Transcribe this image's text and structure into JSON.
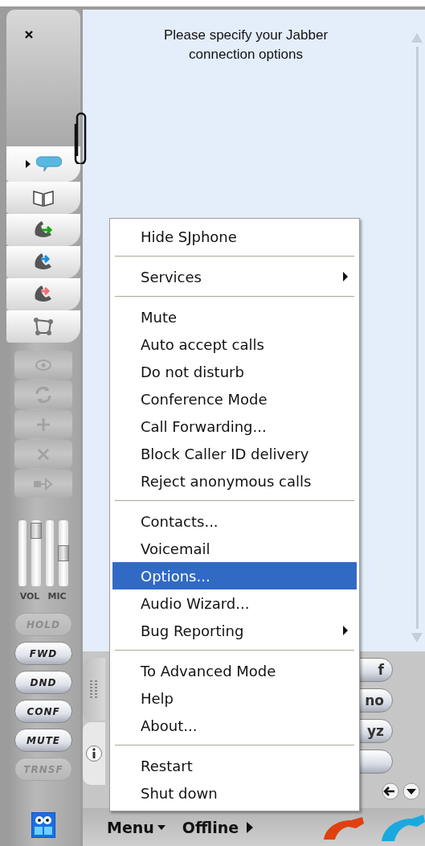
{
  "prompt": "Please specify your Jabber connection options",
  "side_tabs": [
    {
      "kind": "chat",
      "selected": true
    },
    {
      "kind": "book",
      "selected": false
    },
    {
      "kind": "incoming",
      "selected": false
    },
    {
      "kind": "outgoing",
      "selected": false
    },
    {
      "kind": "missed",
      "selected": false
    },
    {
      "kind": "network",
      "selected": false
    }
  ],
  "call_actions": [
    {
      "kind": "record",
      "disabled": true
    },
    {
      "kind": "transfer",
      "disabled": true
    },
    {
      "kind": "add",
      "disabled": true
    },
    {
      "kind": "remove",
      "disabled": true
    },
    {
      "kind": "forward",
      "disabled": true
    }
  ],
  "sliders": [
    {
      "label": "VOL",
      "level": 0.95
    },
    {
      "label": "MIC",
      "level": 0.5
    }
  ],
  "buttons": [
    {
      "label": "HOLD",
      "disabled": true
    },
    {
      "label": "FWD",
      "disabled": false
    },
    {
      "label": "DND",
      "disabled": false
    },
    {
      "label": "CONF",
      "disabled": false
    },
    {
      "label": "MUTE",
      "disabled": false
    },
    {
      "label": "TRNSF",
      "disabled": true
    }
  ],
  "panel_tabs": [
    {
      "kind": "keypad",
      "selected": true
    },
    {
      "kind": "info",
      "selected": false
    }
  ],
  "keypad_keys": [
    {
      "label": "f"
    },
    {
      "label": "no"
    },
    {
      "label": "yz"
    }
  ],
  "bottom_bar": {
    "menu_label": "Menu",
    "status": "Offline"
  },
  "context_menu": {
    "groups": [
      [
        {
          "label": "Hide SJphone",
          "submenu": false,
          "selected": false
        }
      ],
      [
        {
          "label": "Services",
          "submenu": true,
          "selected": false
        }
      ],
      [
        {
          "label": "Mute",
          "submenu": false,
          "selected": false
        },
        {
          "label": "Auto accept calls",
          "submenu": false,
          "selected": false
        },
        {
          "label": "Do not disturb",
          "submenu": false,
          "selected": false
        },
        {
          "label": "Conference Mode",
          "submenu": false,
          "selected": false
        },
        {
          "label": "Call Forwarding...",
          "submenu": false,
          "selected": false
        },
        {
          "label": "Block Caller ID delivery",
          "submenu": false,
          "selected": false
        },
        {
          "label": "Reject anonymous calls",
          "submenu": false,
          "selected": false
        }
      ],
      [
        {
          "label": "Contacts...",
          "submenu": false,
          "selected": false
        },
        {
          "label": "Voicemail",
          "submenu": false,
          "selected": false
        },
        {
          "label": "Options...",
          "submenu": false,
          "selected": true
        },
        {
          "label": "Audio Wizard...",
          "submenu": false,
          "selected": false
        },
        {
          "label": "Bug Reporting",
          "submenu": true,
          "selected": false
        }
      ],
      [
        {
          "label": "To Advanced Mode",
          "submenu": false,
          "selected": false
        },
        {
          "label": "Help",
          "submenu": false,
          "selected": false
        },
        {
          "label": "About...",
          "submenu": false,
          "selected": false
        }
      ],
      [
        {
          "label": "Restart",
          "submenu": false,
          "selected": false
        },
        {
          "label": "Shut down",
          "submenu": false,
          "selected": false
        }
      ]
    ]
  }
}
